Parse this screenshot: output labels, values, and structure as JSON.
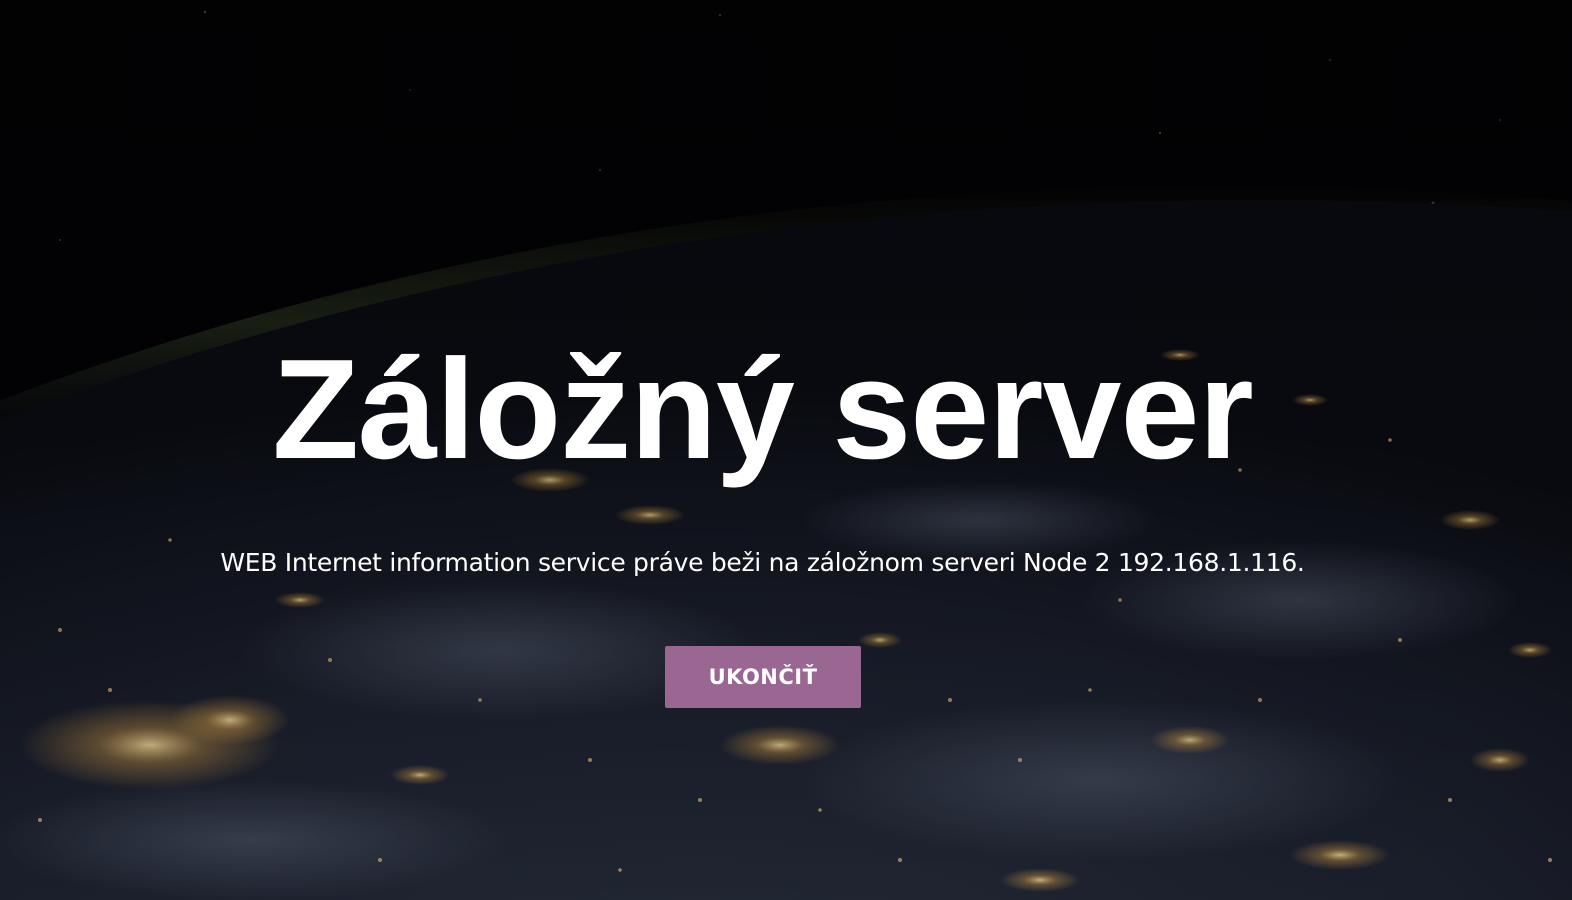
{
  "hero": {
    "title": "Záložný server",
    "subtitle": "WEB Internet information service práve beži na záložnom serveri Node 2 192.168.1.116.",
    "button_label": "UKONČIŤ",
    "background": "night-earth-from-space-image"
  },
  "colors": {
    "button": "#9a6692",
    "text": "#ffffff",
    "background": "#050608"
  }
}
